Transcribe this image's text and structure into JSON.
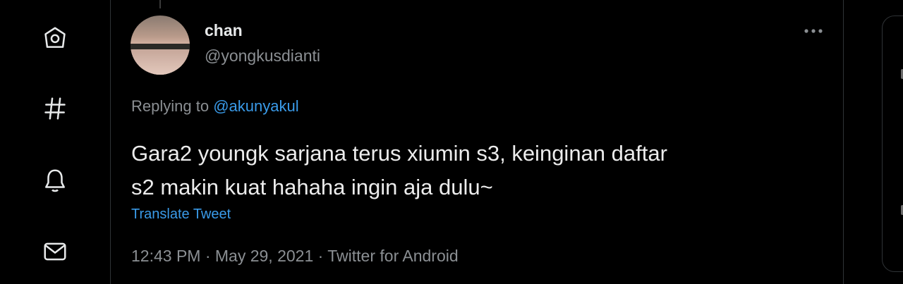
{
  "nav": {
    "items": [
      {
        "icon": "home-icon"
      },
      {
        "icon": "explore-hashtag-icon"
      },
      {
        "icon": "notifications-bell-icon"
      },
      {
        "icon": "messages-envelope-icon"
      }
    ]
  },
  "tweet": {
    "display_name": "chan",
    "handle": "@yongkusdianti",
    "replying_prefix": "Replying to",
    "replying_to": "@akunyakul",
    "text_line1": "Gara2 youngk sarjana terus xiumin s3, keinginan daftar",
    "text_line2": "s2 makin kuat hahaha ingin aja dulu~",
    "translate_label": "Translate Tweet",
    "timestamp": "12:43 PM · May 29, 2021 · Twitter for Android"
  },
  "colors": {
    "background": "#000000",
    "accent": "#3a9be9",
    "secondary_text": "#8b8f93",
    "primary_text": "#ececec",
    "border": "#2f3336"
  }
}
